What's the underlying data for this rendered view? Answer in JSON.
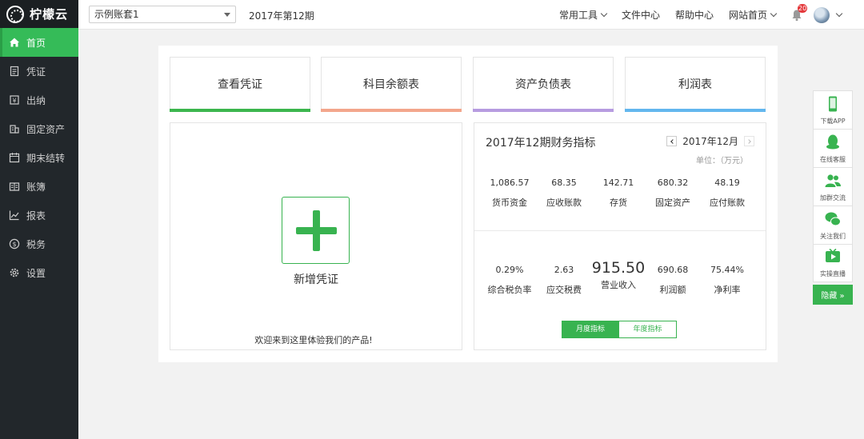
{
  "brand": {
    "name": "柠檬云"
  },
  "sidebar": {
    "items": [
      {
        "label": "首页",
        "icon": "home-icon"
      },
      {
        "label": "凭证",
        "icon": "voucher-icon"
      },
      {
        "label": "出纳",
        "icon": "cashier-icon"
      },
      {
        "label": "固定资产",
        "icon": "building-icon"
      },
      {
        "label": "期末结转",
        "icon": "calendar-icon"
      },
      {
        "label": "账簿",
        "icon": "book-icon"
      },
      {
        "label": "报表",
        "icon": "chart-icon"
      },
      {
        "label": "税务",
        "icon": "dollar-icon"
      },
      {
        "label": "设置",
        "icon": "gear-icon"
      }
    ]
  },
  "topbar": {
    "account": "示例账套1",
    "period": "2017年第12期",
    "nav": [
      "常用工具",
      "文件中心",
      "帮助中心",
      "网站首页"
    ],
    "notifications": "20"
  },
  "quick_actions": [
    {
      "label": "查看凭证",
      "color": "#3cb64e"
    },
    {
      "label": "科目余额表",
      "color": "#f3a68c"
    },
    {
      "label": "资产负债表",
      "color": "#b79ce0"
    },
    {
      "label": "利润表",
      "color": "#63b7ee"
    }
  ],
  "voucher_panel": {
    "add_label": "新增凭证",
    "welcome": "欢迎来到这里体验我们的产品!"
  },
  "indicators": {
    "title": "2017年12期财务指标",
    "month": "2017年12月",
    "unit": "单位：（万元）",
    "row1": [
      {
        "value": "1,086.57",
        "label": "货币资金"
      },
      {
        "value": "68.35",
        "label": "应收账款"
      },
      {
        "value": "142.71",
        "label": "存货"
      },
      {
        "value": "680.32",
        "label": "固定资产"
      },
      {
        "value": "48.19",
        "label": "应付账款"
      }
    ],
    "row2": [
      {
        "value": "0.29%",
        "label": "综合税负率"
      },
      {
        "value": "2.63",
        "label": "应交税费"
      },
      {
        "value": "915.50",
        "label": "营业收入"
      },
      {
        "value": "690.68",
        "label": "利润额"
      },
      {
        "value": "75.44%",
        "label": "净利率"
      }
    ],
    "toggle": {
      "monthly": "月度指标",
      "yearly": "年度指标"
    }
  },
  "floatbar": {
    "items": [
      "下载APP",
      "在线客服",
      "加群交流",
      "关注我们",
      "实操直播"
    ],
    "hide": "隐藏 »"
  },
  "colors": {
    "accent": "#38b350",
    "sidebar_bg": "#22272b"
  }
}
